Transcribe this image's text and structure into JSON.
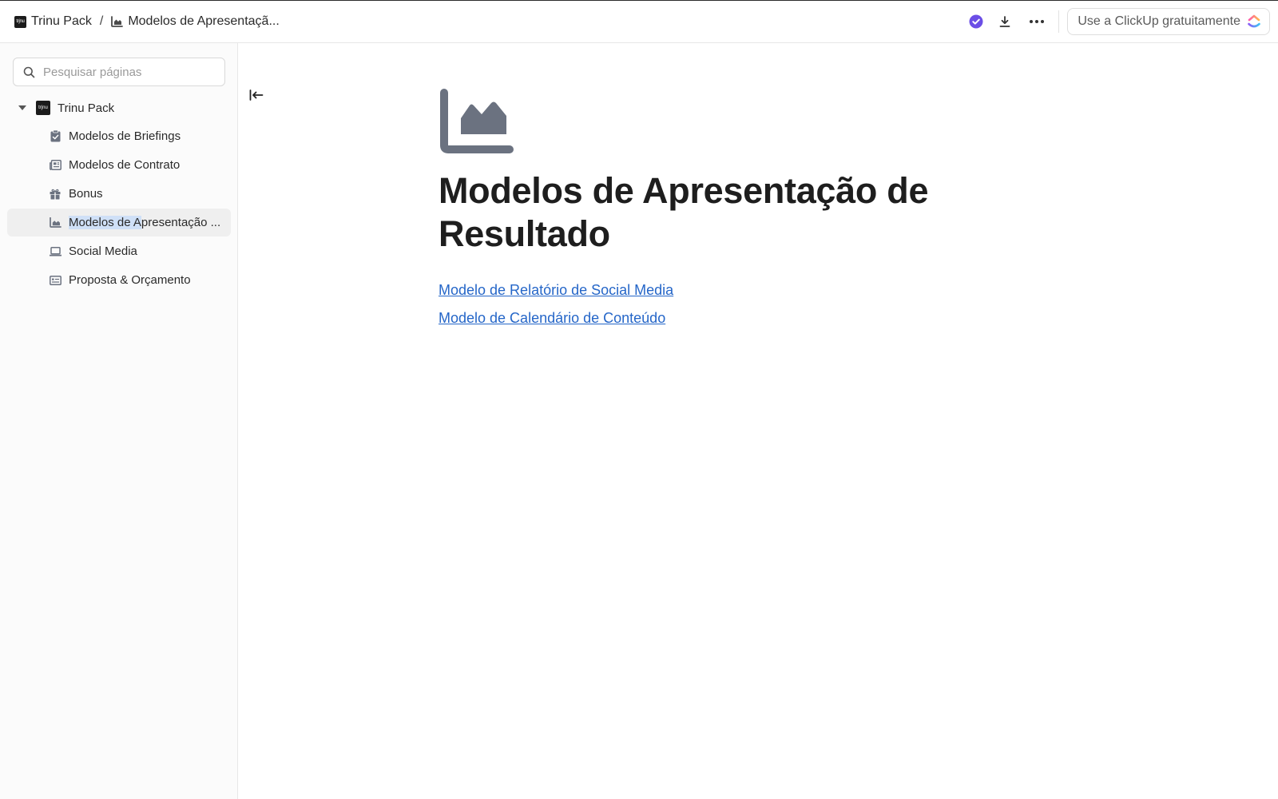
{
  "topbar": {
    "workspace_logo_text": "trjnu",
    "workspace_name": "Trinu Pack",
    "separator": "/",
    "current_page": "Modelos de Apresentaçã...",
    "cta_label": "Use a ClickUp gratuitamente"
  },
  "sidebar": {
    "search_placeholder": "Pesquisar páginas",
    "root": {
      "label": "Trinu Pack",
      "logo_text": "trjnu"
    },
    "items": [
      {
        "label": "Modelos de Briefings",
        "icon": "clipboard-check-icon"
      },
      {
        "label": "Modelos de Contrato",
        "icon": "newspaper-icon"
      },
      {
        "label": "Bonus",
        "icon": "gift-icon"
      },
      {
        "label_selected": "Modelos de A",
        "label_rest": "presentação ...",
        "icon": "area-chart-icon",
        "active": true
      },
      {
        "label": "Social Media",
        "icon": "laptop-icon"
      },
      {
        "label": "Proposta & Orçamento",
        "icon": "id-card-icon"
      }
    ]
  },
  "main": {
    "page_icon": "area-chart-icon",
    "title": "Modelos de Apresentação de Resultado",
    "links": [
      "Modelo de Relatório de Social Media",
      "Modelo de Calendário de Conteúdo"
    ]
  },
  "colors": {
    "link": "#2566c8",
    "icon_gray": "#6b7280",
    "verified_purple": "#6b4ee6",
    "active_item_bg": "#efefef",
    "text_selection": "#cfe0f7"
  }
}
